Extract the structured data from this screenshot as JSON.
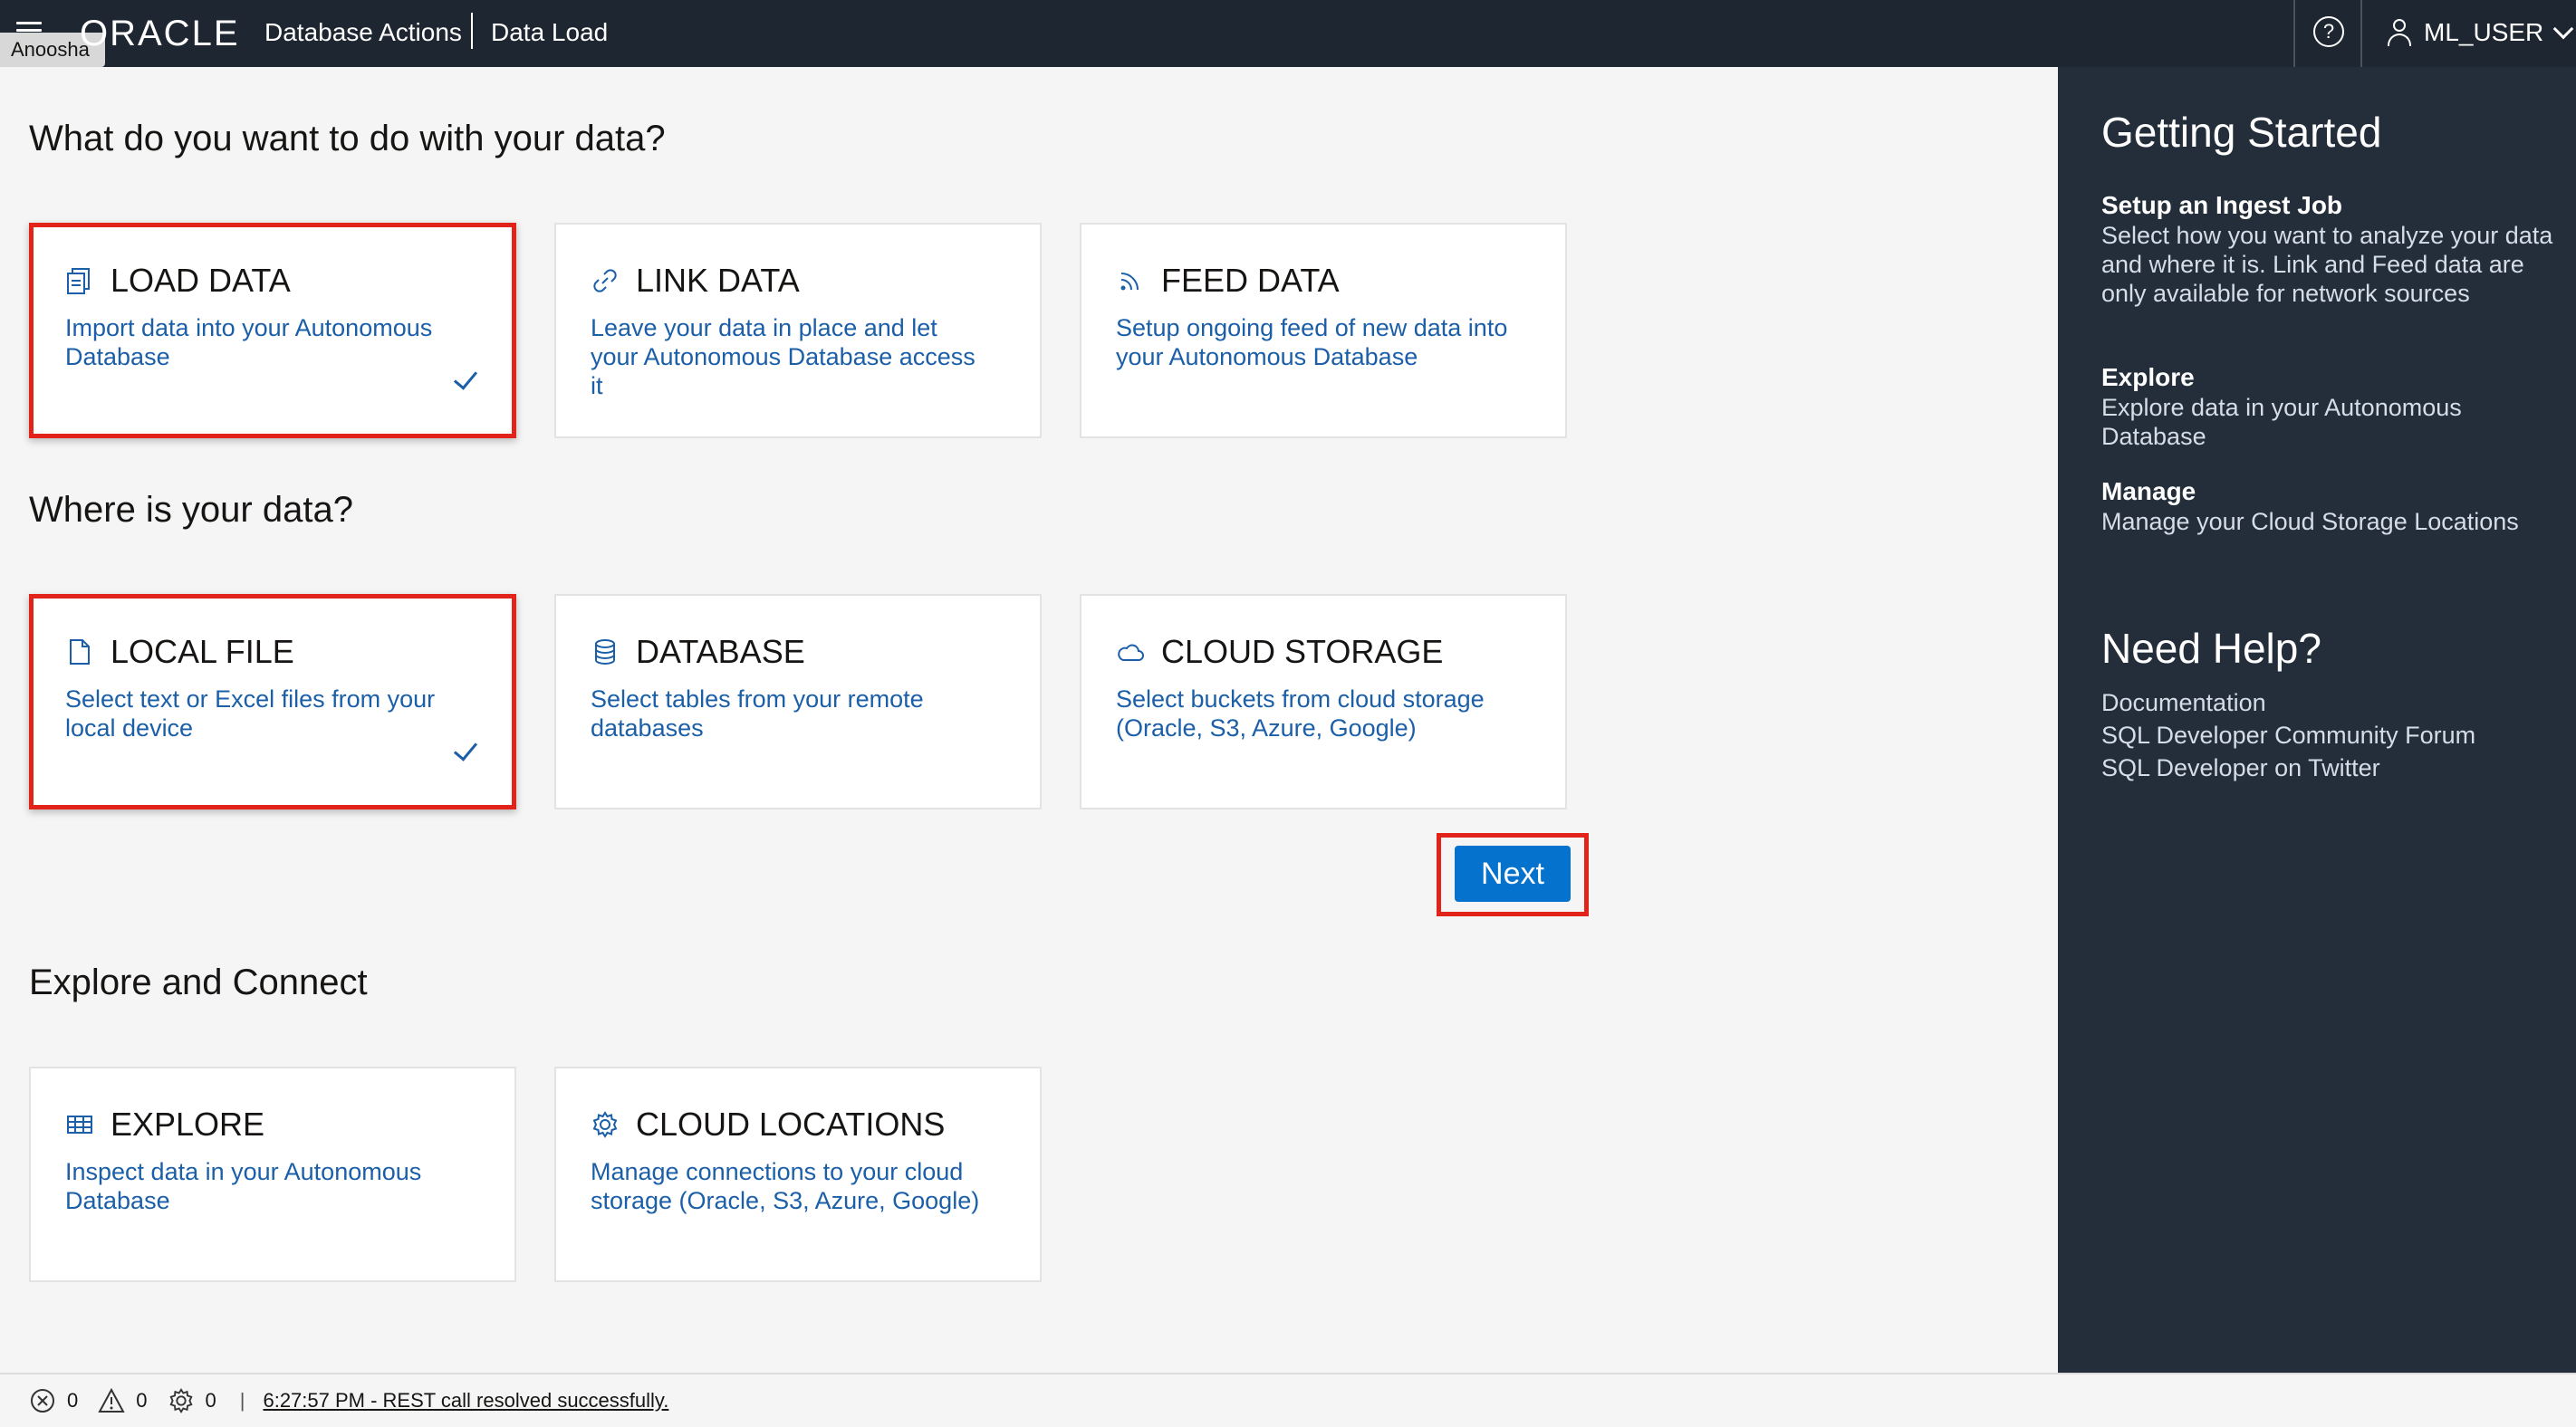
{
  "header": {
    "logo": "ORACLE",
    "app_title": "Database Actions",
    "page_name": "Data Load",
    "user_chip": "Anoosha",
    "help_symbol": "?",
    "user_name": "ML_USER"
  },
  "sections": {
    "what": "What do you want to do with your data?",
    "where": "Where is your data?",
    "explore": "Explore and Connect"
  },
  "cards": {
    "load": {
      "title": "LOAD DATA",
      "desc": "Import data into your Autonomous Database",
      "icon": "copy-icon",
      "selected": true
    },
    "link": {
      "title": "LINK DATA",
      "desc": "Leave your data in place and let your Autonomous Database access it",
      "icon": "link-icon",
      "selected": false
    },
    "feed": {
      "title": "FEED DATA",
      "desc": "Setup ongoing feed of new data into your Autonomous Database",
      "icon": "feed-icon",
      "selected": false
    },
    "local": {
      "title": "LOCAL FILE",
      "desc": "Select text or Excel files from your local device",
      "icon": "file-icon",
      "selected": true
    },
    "database": {
      "title": "DATABASE",
      "desc": "Select tables from your remote databases",
      "icon": "database-icon",
      "selected": false
    },
    "cloud": {
      "title": "CLOUD STORAGE",
      "desc": "Select buckets from cloud storage (Oracle, S3, Azure, Google)",
      "icon": "cloud-icon",
      "selected": false
    },
    "explore": {
      "title": "EXPLORE",
      "desc": "Inspect data in your Autonomous Database",
      "icon": "table-icon",
      "selected": false
    },
    "locations": {
      "title": "CLOUD LOCATIONS",
      "desc": "Manage connections to your cloud storage (Oracle, S3, Azure, Google)",
      "icon": "gear-icon",
      "selected": false
    }
  },
  "next_label": "Next",
  "side": {
    "getting_started": "Getting Started",
    "items": [
      {
        "title": "Setup an Ingest Job",
        "text": "Select how you want to analyze your data and where it is. Link and Feed data are only available for network sources"
      },
      {
        "title": "Explore",
        "text": "Explore data in your Autonomous Database"
      },
      {
        "title": "Manage",
        "text": "Manage your Cloud Storage Locations"
      }
    ],
    "need_help": "Need Help?",
    "links": [
      "Documentation",
      "SQL Developer Community Forum",
      "SQL Developer on Twitter"
    ]
  },
  "status": {
    "errors": "0",
    "warnings": "0",
    "tasks": "0",
    "separator": "|",
    "message": "6:27:57 PM - REST call resolved successfully."
  },
  "colors": {
    "header_bg": "#1e2631",
    "side_bg": "#242e3b",
    "accent_blue": "#0572ce",
    "link_blue": "#1b5fa8",
    "highlight_red": "#e2231a"
  }
}
